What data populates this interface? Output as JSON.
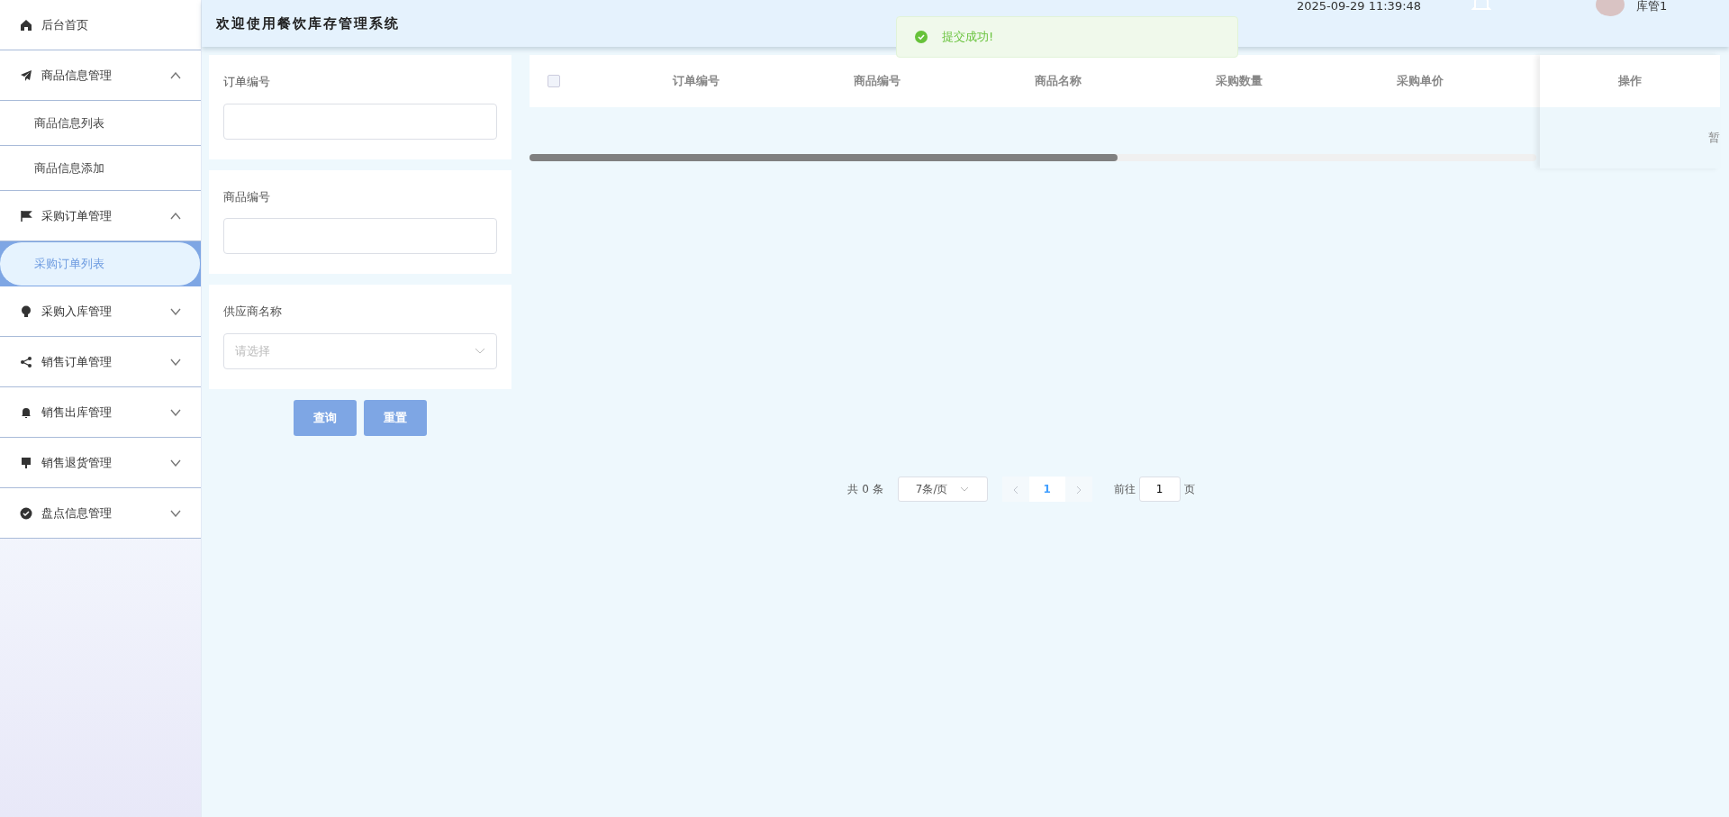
{
  "sidebar": {
    "items": [
      {
        "label": "后台首页"
      },
      {
        "label": "商品信息管理",
        "expanded": true,
        "children": [
          {
            "label": "商品信息列表",
            "selected": false
          },
          {
            "label": "商品信息添加",
            "selected": false
          }
        ]
      },
      {
        "label": "采购订单管理",
        "expanded": true,
        "children": [
          {
            "label": "采购订单列表",
            "selected": true
          }
        ]
      },
      {
        "label": "采购入库管理",
        "expanded": false
      },
      {
        "label": "销售订单管理",
        "expanded": false
      },
      {
        "label": "销售出库管理",
        "expanded": false
      },
      {
        "label": "销售退货管理",
        "expanded": false
      },
      {
        "label": "盘点信息管理",
        "expanded": false
      }
    ]
  },
  "header": {
    "title": "欢迎使用餐饮库存管理系统",
    "datetime": "2025-09-29 11:39:48",
    "user": "库管1"
  },
  "toast": {
    "message": "提交成功!"
  },
  "filters": [
    {
      "kind": "input",
      "label": "订单编号"
    },
    {
      "kind": "input",
      "label": "商品编号"
    },
    {
      "kind": "select",
      "label": "供应商名称",
      "placeholder": "请选择"
    }
  ],
  "filter_buttons": [
    "查询",
    "重置"
  ],
  "table": {
    "columns": [
      "订单编号",
      "商品编号",
      "商品名称",
      "采购数量",
      "采购单价"
    ],
    "action_column": "操作",
    "empty_text": "暂",
    "select_all_checked": false
  },
  "pagination": {
    "total": "共 0 条",
    "page_size": "7条/页",
    "pages": [
      {
        "label": "1",
        "selected": true
      }
    ],
    "goto_label": "前往",
    "goto_value": "1",
    "goto_suffix": "页"
  }
}
